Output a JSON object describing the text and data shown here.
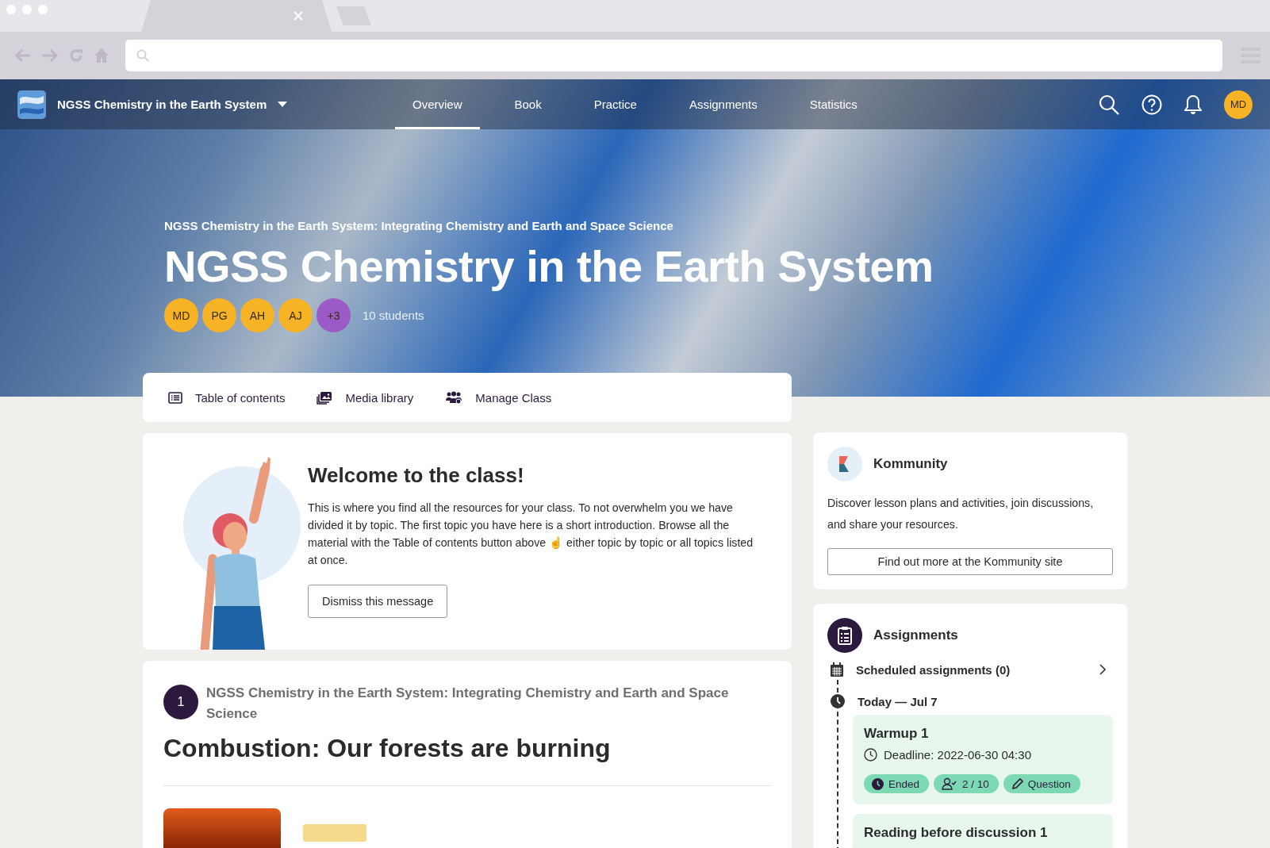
{
  "course_nav": {
    "title": "NGSS Chemistry in the Earth System",
    "tabs": [
      {
        "label": "Overview",
        "selected": true
      },
      {
        "label": "Book",
        "selected": false
      },
      {
        "label": "Practice",
        "selected": false
      },
      {
        "label": "Assignments",
        "selected": false
      },
      {
        "label": "Statistics",
        "selected": false
      }
    ],
    "avatar": "MD"
  },
  "hero": {
    "subtitle": "NGSS Chemistry in the Earth System: Integrating Chemistry and Earth and Space Science",
    "title": "NGSS Chemistry in the Earth System",
    "members": [
      {
        "initials": "MD",
        "color": "#f5b325"
      },
      {
        "initials": "PG",
        "color": "#f5b325"
      },
      {
        "initials": "AH",
        "color": "#f5b325"
      },
      {
        "initials": "AJ",
        "color": "#f5b325"
      },
      {
        "initials": "+3",
        "color": "#9a5bc6"
      }
    ],
    "student_count": "10 students"
  },
  "toolbar": [
    {
      "kind": "list",
      "label": "Table of contents"
    },
    {
      "kind": "media",
      "label": "Media library"
    },
    {
      "kind": "people",
      "label": "Manage Class"
    }
  ],
  "welcome": {
    "title": "Welcome to the class!",
    "body": "This is where you find all the resources for your class. To not overwhelm you we have divided it by topic. The first topic you have here is a short introduction. Browse all the material with the Table of contents button above ☝ either topic by topic or all topics listed at once.",
    "button": "Dismiss this message"
  },
  "topic": {
    "number": "1",
    "subtitle": "NGSS Chemistry in the Earth System: Integrating Chemistry and Earth and Space Science",
    "title": "Combustion: Our forests are burning"
  },
  "kommunity": {
    "title": "Kommunity",
    "body": "Discover lesson plans and activities, join discussions, and share your resources.",
    "button": "Find out more at the Kommunity site"
  },
  "assignments": {
    "title": "Assignments",
    "scheduled": "Scheduled assignments (0)",
    "date": "Today — Jul 7",
    "items": [
      {
        "title": "Warmup 1",
        "deadline": "Deadline: 2022-06-30 04:30",
        "tags": [
          {
            "kind": "status",
            "label": "Ended"
          },
          {
            "kind": "students",
            "label": "2 / 10"
          },
          {
            "kind": "type",
            "label": "Question"
          }
        ]
      },
      {
        "title": "Reading before discussion 1"
      }
    ]
  }
}
